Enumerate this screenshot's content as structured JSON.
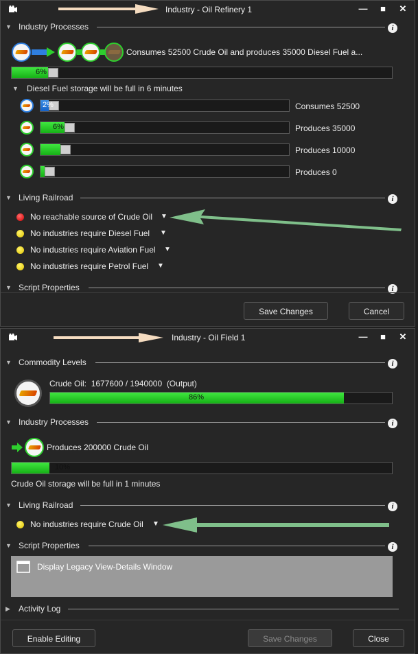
{
  "window1": {
    "title": "Industry - Oil Refinery 1",
    "industry_processes": {
      "label": "Industry Processes",
      "summary": "Consumes 52500 Crude Oil and produces 35000 Diesel Fuel a...",
      "progress": "6%",
      "progress_value": 0.06
    },
    "storage": {
      "label": "Diesel Fuel storage will be full in 6 minutes",
      "rows": [
        {
          "pct": "2%",
          "value": 0.02,
          "color": "blue",
          "label": "Consumes 52500"
        },
        {
          "pct": "6%",
          "value": 0.06,
          "color": "green",
          "label": "Produces 35000"
        },
        {
          "pct": "",
          "value": 0.05,
          "color": "green",
          "label": "Produces 10000"
        },
        {
          "pct": "",
          "value": 0.01,
          "color": "green",
          "label": "Produces 0"
        }
      ]
    },
    "living_railroad": {
      "label": "Living Railroad",
      "items": [
        {
          "status": "red",
          "text": "No reachable source of Crude Oil"
        },
        {
          "status": "yellow",
          "text": "No industries require Diesel Fuel"
        },
        {
          "status": "yellow",
          "text": "No industries require Aviation Fuel"
        },
        {
          "status": "yellow",
          "text": "No industries require Petrol Fuel"
        }
      ]
    },
    "script_properties": {
      "label": "Script Properties"
    },
    "buttons": {
      "save": "Save Changes",
      "cancel": "Cancel"
    }
  },
  "window2": {
    "title": "Industry - Oil Field 1",
    "commodity_levels": {
      "label": "Commodity Levels",
      "name": "Crude Oil:",
      "amount": "1677600 / 1940000",
      "kind": "(Output)",
      "progress": "86%",
      "progress_value": 0.86
    },
    "industry_processes": {
      "label": "Industry Processes",
      "summary": "Produces 200000 Crude Oil",
      "progress": "10%",
      "progress_value": 0.1,
      "storage_text": "Crude Oil storage will be full in 1 minutes"
    },
    "living_railroad": {
      "label": "Living Railroad",
      "items": [
        {
          "status": "yellow",
          "text": "No industries require Crude Oil"
        }
      ]
    },
    "script_properties": {
      "label": "Script Properties",
      "legacy_button": "Display Legacy View-Details Window"
    },
    "activity_log": {
      "label": "Activity Log"
    },
    "buttons": {
      "enable_editing": "Enable Editing",
      "save": "Save Changes",
      "close": "Close"
    }
  },
  "colors": {
    "accent_green": "#2ecf2e",
    "progress_blue": "#1f72d6",
    "annotation_arrow": "#7fbf8a",
    "annotation_peach": "#f5dcc0"
  },
  "icons": {
    "title_icon": "camera-icon",
    "minimize": "minimize-icon",
    "maximize": "maximize-icon",
    "close": "close-icon",
    "info": "info-icon",
    "dropdown": "triangle-down-icon"
  }
}
